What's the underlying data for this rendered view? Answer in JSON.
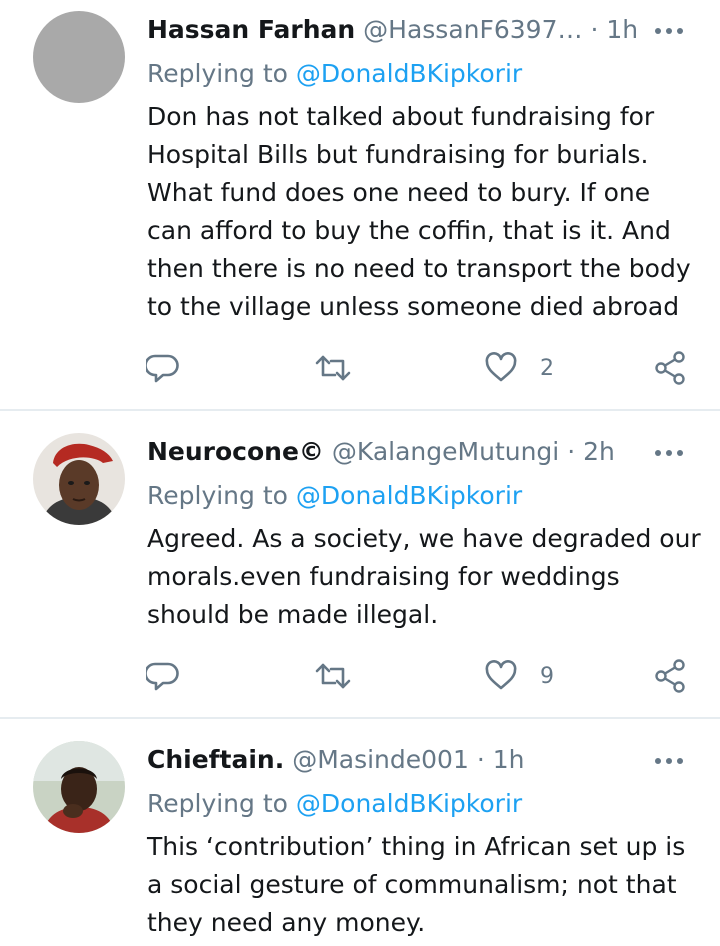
{
  "tweets": [
    {
      "name": "Hassan Farhan",
      "handle": "@HassanF6397…",
      "separator": "·",
      "time": "1h",
      "replying_label": "Replying to",
      "replying_to": "@DonaldBKipkorir",
      "lines": [
        "Don has not talked about fundraising for",
        "Hospital Bills but fundraising for burials.",
        "What fund does one need to bury. If one",
        "can afford to buy the coffin, that is it. And",
        "then there is no need to transport the body",
        "to the village unless someone died abroad"
      ],
      "likes": "2"
    },
    {
      "name": "Neurocone©",
      "handle": "@KalangeMutungi",
      "separator": "·",
      "time": "2h",
      "replying_label": "Replying to",
      "replying_to": "@DonaldBKipkorir",
      "lines": [
        "Agreed. As a society, we have degraded our",
        "morals.even fundraising for weddings",
        "should be made illegal."
      ],
      "likes": "9"
    },
    {
      "name": "Chieftain.",
      "handle": "@Masinde001",
      "separator": "·",
      "time": "1h",
      "replying_label": "Replying to",
      "replying_to": "@DonaldBKipkorir",
      "lines": [
        "This ‘contribution’ thing in African set up is",
        "a social gesture of communalism; not that",
        "they need any money."
      ]
    }
  ],
  "icons": {
    "reply": "reply-icon",
    "retweet": "retweet-icon",
    "like": "heart-icon",
    "share": "share-icon",
    "more": "more-icon"
  },
  "colors": {
    "text": "#14171a",
    "secondary": "#657786",
    "link": "#1da1f2",
    "divider": "#e6ecf0"
  }
}
